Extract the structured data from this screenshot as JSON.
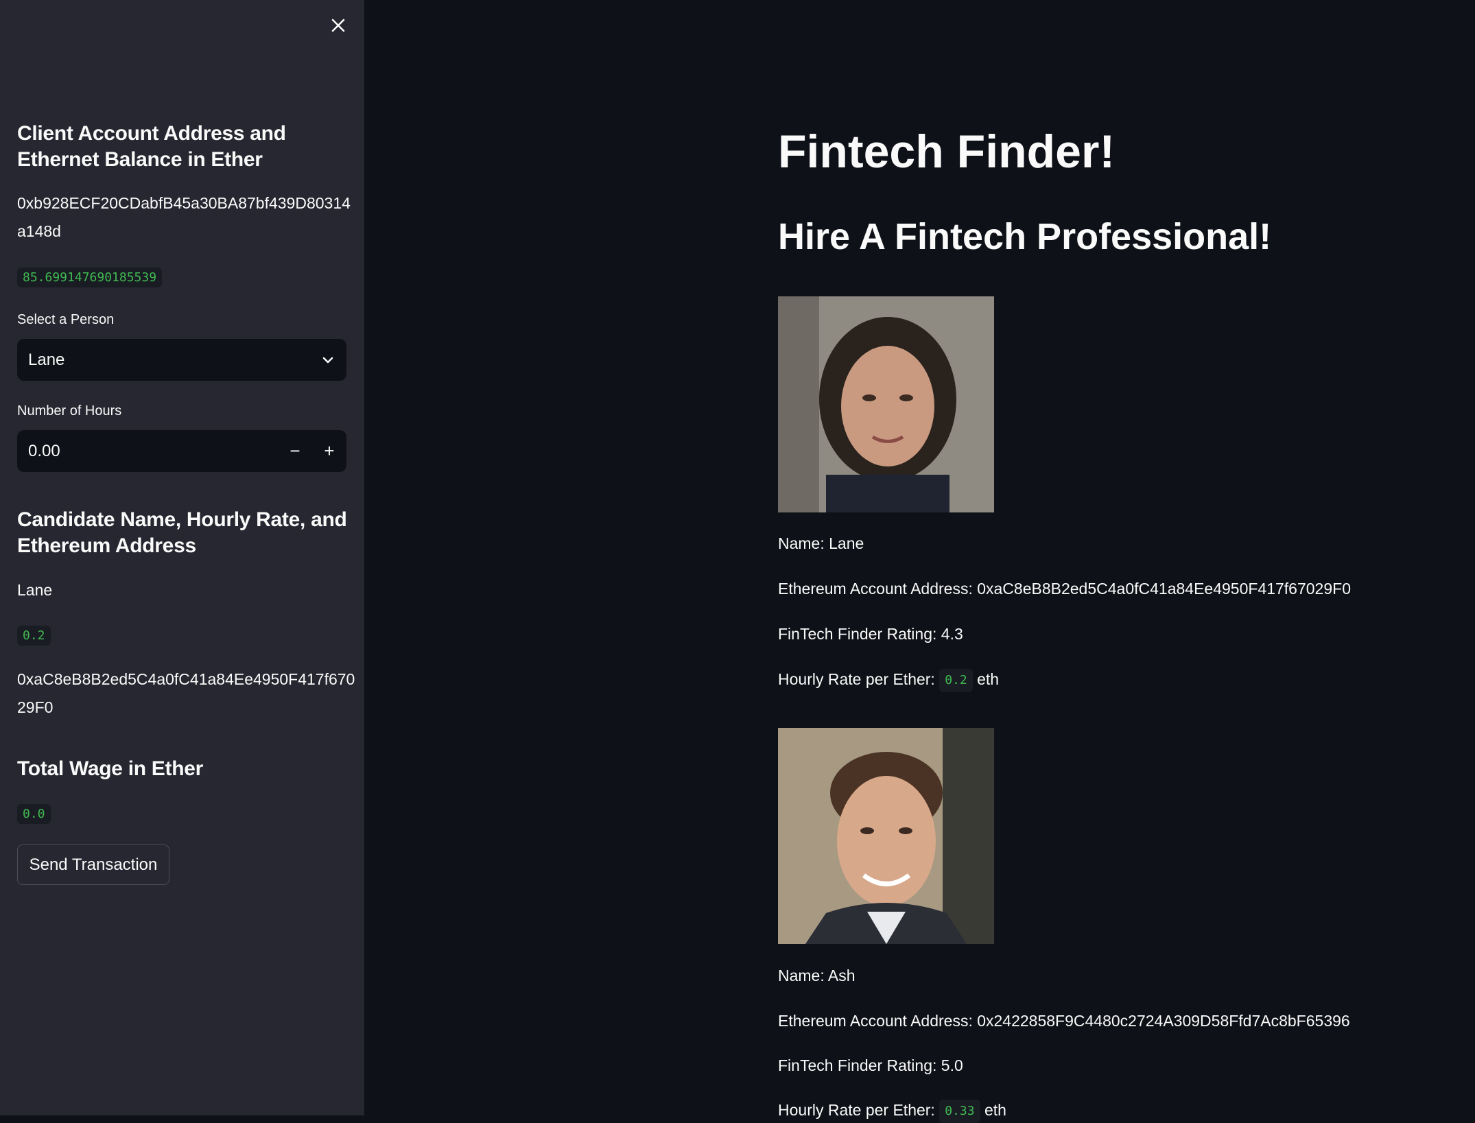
{
  "sidebar": {
    "client_heading": "Client Account Address and Ethernet Balance in Ether",
    "client_address_line1": "0xb928ECF20CDabfB45a30BA87bf439D80314",
    "client_address_line2": "a148d",
    "client_balance": "85.699147690185539",
    "select_label": "Select a Person",
    "select_value": "Lane",
    "hours_label": "Number of Hours",
    "hours_value": "0.00",
    "minus": "−",
    "plus": "+",
    "candidate_heading": "Candidate Name, Hourly Rate, and Ethereum Address",
    "candidate_name": "Lane",
    "candidate_rate": "0.2",
    "candidate_address_line1": "0xaC8eB8B2ed5C4a0fC41a84Ee4950F417f670",
    "candidate_address_line2": "29F0",
    "wage_heading": "Total Wage in Ether",
    "wage_value": "0.0",
    "send_button": "Send Transaction"
  },
  "main": {
    "title": "Fintech Finder!",
    "subtitle": "Hire A Fintech Professional!",
    "candidates": [
      {
        "name": "Name: Lane",
        "address": "Ethereum Account Address: 0xaC8eB8B2ed5C4a0fC41a84Ee4950F417f67029F0",
        "rating": "FinTech Finder Rating: 4.3",
        "rate_label": "Hourly Rate per Ether:",
        "rate": "0.2",
        "unit": "eth"
      },
      {
        "name": "Name: Ash",
        "address": "Ethereum Account Address: 0x2422858F9C4480c2724A309D58Ffd7Ac8bF65396",
        "rating": "FinTech Finder Rating: 5.0",
        "rate_label": "Hourly Rate per Ether:",
        "rate": "0.33",
        "unit": "eth"
      }
    ]
  }
}
